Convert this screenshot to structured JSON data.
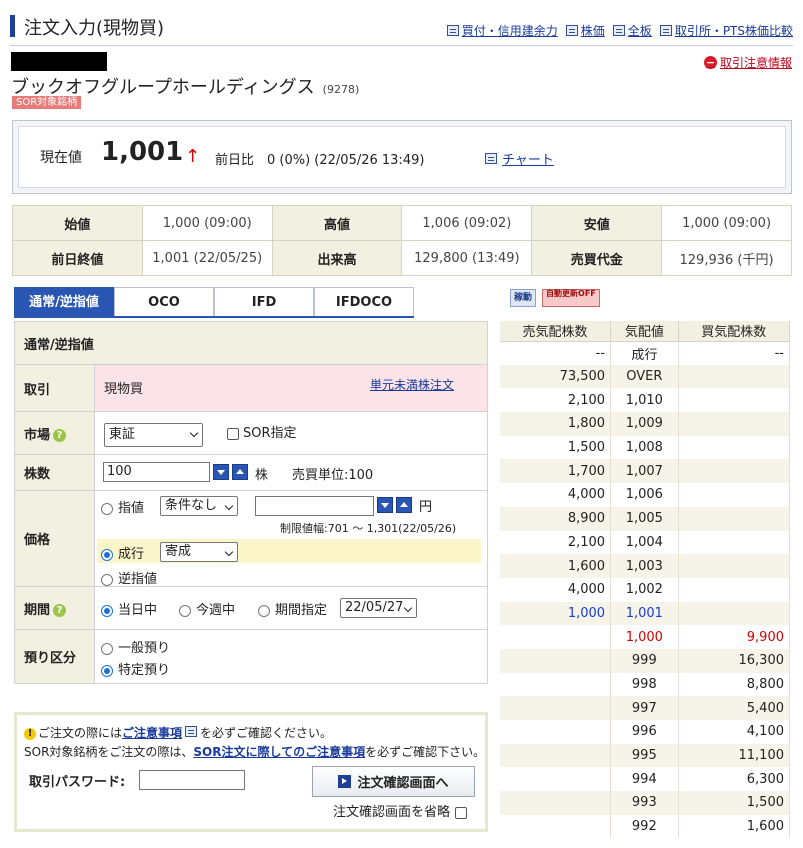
{
  "header": {
    "title": "注文入力(現物買)",
    "links": [
      "買付・信用建余力",
      "株価",
      "全板",
      "取引所・PTS株価比較"
    ]
  },
  "warning_link": "取引注意情報",
  "company": {
    "name": "ブックオフグループホールディングス",
    "code": "(9278)",
    "badge": "SOR対象銘柄"
  },
  "price": {
    "label": "現在値",
    "value": "1,001",
    "arrow": "↑",
    "change": "前日比　0 (0%) (22/05/26 13:49)",
    "chart_link": "チャート"
  },
  "ohlc": [
    [
      {
        "h": "始値",
        "v": "1,000 (09:00)"
      },
      {
        "h": "高値",
        "v": "1,006 (09:02)"
      },
      {
        "h": "安値",
        "v": "1,000 (09:00)"
      }
    ],
    [
      {
        "h": "前日終値",
        "v": "1,001 (22/05/25)"
      },
      {
        "h": "出来高",
        "v": "129,800 (13:49)"
      },
      {
        "h": "売買代金",
        "v": "129,936 (千円)"
      }
    ]
  ],
  "tabs": [
    "通常/逆指値",
    "OCO",
    "IFD",
    "IFDOCO"
  ],
  "form": {
    "section": "通常/逆指値",
    "trade_label": "取引",
    "trade_value": "現物買",
    "odd_lot_link": "単元未満株注文",
    "market_label": "市場",
    "market_value": "東証",
    "sor_label": "SOR指定",
    "qty_label": "株数",
    "qty_value": "100",
    "qty_unit": "株",
    "unit_text": "売買単位:100",
    "price_label": "価格",
    "limit_label": "指値",
    "cond_value": "条件なし",
    "price_placeholder": "",
    "yen": "円",
    "limit_range": "制限値幅:701 〜 1,301(22/05/26)",
    "market_order_label": "成行",
    "market_order_cond": "寄成",
    "stop_label": "逆指値",
    "period_label": "期間",
    "today": "当日中",
    "this_week": "今週中",
    "period_spec": "期間指定",
    "period_date": "22/05/27",
    "account_label": "預り区分",
    "general": "一般預り",
    "specific": "特定預り"
  },
  "notice": {
    "line1_pre": "ご注文の際には",
    "line1_link": "ご注意事項",
    "line1_post": "を必ずご確認ください。",
    "line2_pre": "SOR対象銘柄をご注文の際は、",
    "line2_link": "SOR注文に際してのご注意事項",
    "line2_post": "を必ずご確認下さい。",
    "password_label": "取引パスワード:",
    "password_value": "",
    "confirm_button": "注文確認画面へ",
    "skip_label": "注文確認画面を省略"
  },
  "board": {
    "buttons": [
      "稼動",
      "自動更新OFF"
    ],
    "headers": [
      "売気配株数",
      "気配値",
      "買気配株数"
    ],
    "rows": [
      [
        "--",
        "成行",
        "--"
      ],
      [
        "73,500",
        "OVER",
        ""
      ],
      [
        "2,100",
        "1,010",
        ""
      ],
      [
        "1,800",
        "1,009",
        ""
      ],
      [
        "1,500",
        "1,008",
        ""
      ],
      [
        "1,700",
        "1,007",
        ""
      ],
      [
        "4,000",
        "1,006",
        ""
      ],
      [
        "8,900",
        "1,005",
        ""
      ],
      [
        "2,100",
        "1,004",
        ""
      ],
      [
        "1,600",
        "1,003",
        ""
      ],
      [
        "4,000",
        "1,002",
        ""
      ],
      [
        "1,000",
        "1,001",
        ""
      ],
      [
        "",
        "1,000",
        "9,900"
      ],
      [
        "",
        "999",
        "16,300"
      ],
      [
        "",
        "998",
        "8,800"
      ],
      [
        "",
        "997",
        "5,400"
      ],
      [
        "",
        "996",
        "4,100"
      ],
      [
        "",
        "995",
        "11,100"
      ],
      [
        "",
        "994",
        "6,300"
      ],
      [
        "",
        "993",
        "1,500"
      ],
      [
        "",
        "992",
        "1,600"
      ]
    ]
  },
  "colors": {
    "accent": "#2a56b3",
    "ask_highlight": "#1a3cd8",
    "bid_highlight": "#d40000",
    "header_bg": "#f2f0e1"
  }
}
